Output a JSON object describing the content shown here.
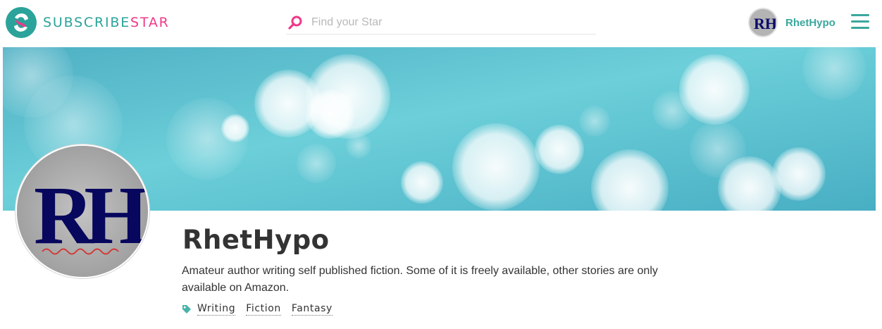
{
  "colors": {
    "brand_teal": "#2ba39a",
    "brand_pink": "#ee3a88",
    "accent": "#3aa79c",
    "text": "#333333"
  },
  "header": {
    "logo": {
      "icon": "subscribestar-logo-icon",
      "text_part1": "SUBSCRIBE",
      "text_part2": "STAR"
    },
    "search": {
      "icon": "search-icon",
      "placeholder": "Find your Star",
      "value": ""
    },
    "user": {
      "avatar_monogram": "RH",
      "name": "RhetHypo"
    },
    "menu": {
      "icon": "hamburger-menu-icon"
    }
  },
  "cover": {
    "image": "teal-bokeh-cover-image"
  },
  "profile": {
    "avatar_monogram": "RH",
    "name": "RhetHypo",
    "bio": "Amateur author writing self published fiction. Some of it is freely available, other stories are only available on Amazon.",
    "tag_icon": "tag-icon",
    "tags": [
      "Writing",
      "Fiction",
      "Fantasy"
    ]
  }
}
